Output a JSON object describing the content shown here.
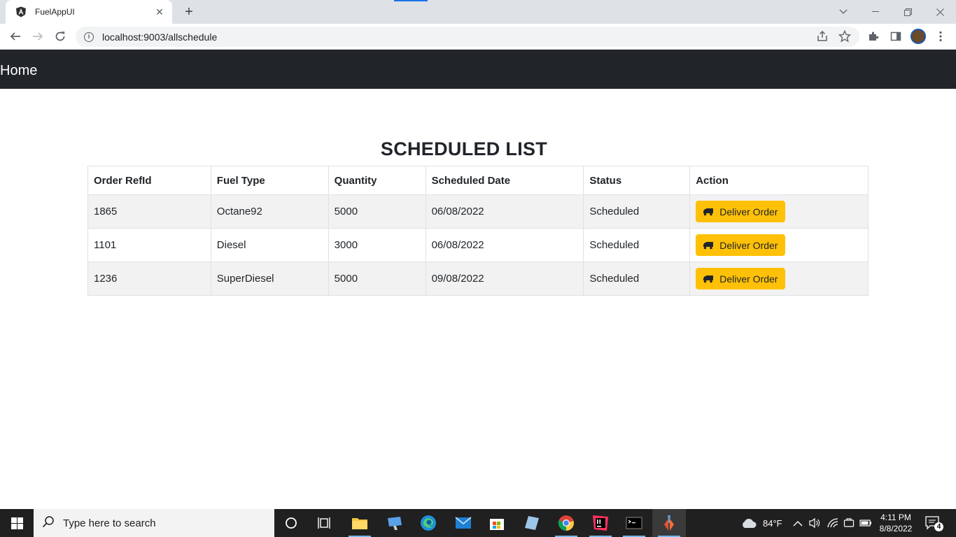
{
  "browser": {
    "tab_title": "FuelAppUI",
    "new_tab_symbol": "+",
    "url": "localhost:9003/allschedule"
  },
  "navbar": {
    "brand": "Home"
  },
  "page": {
    "title": "SCHEDULED LIST"
  },
  "table": {
    "headers": [
      "Order RefId",
      "Fuel Type",
      "Quantity",
      "Scheduled Date",
      "Status",
      "Action"
    ],
    "rows": [
      {
        "ref": "1865",
        "fuel": "Octane92",
        "qty": "5000",
        "date": "06/08/2022",
        "status": "Scheduled",
        "action": "Deliver Order"
      },
      {
        "ref": "1101",
        "fuel": "Diesel",
        "qty": "3000",
        "date": "06/08/2022",
        "status": "Scheduled",
        "action": "Deliver Order"
      },
      {
        "ref": "1236",
        "fuel": "SuperDiesel",
        "qty": "5000",
        "date": "09/08/2022",
        "status": "Scheduled",
        "action": "Deliver Order"
      }
    ]
  },
  "taskbar": {
    "search_placeholder": "Type here to search",
    "weather": "84°F",
    "time": "4:11 PM",
    "date": "8/8/2022",
    "notification_count": "4"
  },
  "colors": {
    "navbar_bg": "#212529",
    "button_warning": "#ffc107",
    "stripe": "#f2f2f2"
  }
}
